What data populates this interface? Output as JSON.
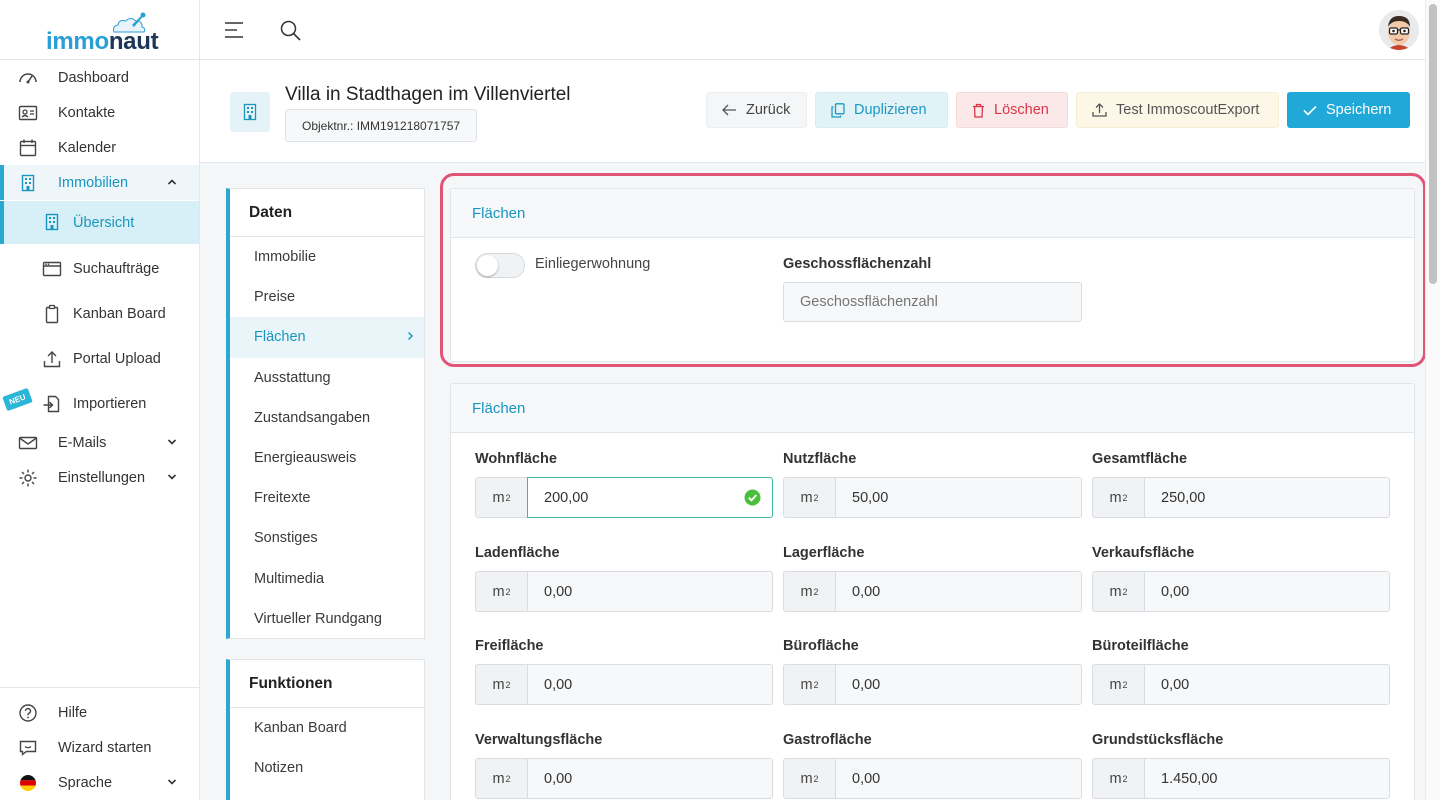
{
  "app": {
    "logo_part1": "immo",
    "logo_part2": "naut"
  },
  "sidebar": {
    "items": [
      {
        "label": "Dashboard",
        "icon": "dashboard-icon"
      },
      {
        "label": "Kontakte",
        "icon": "contacts-icon"
      },
      {
        "label": "Kalender",
        "icon": "calendar-icon"
      },
      {
        "label": "Immobilien",
        "icon": "building-icon"
      },
      {
        "label": "Übersicht",
        "icon": "building-icon"
      },
      {
        "label": "Suchaufträge",
        "icon": "browser-icon"
      },
      {
        "label": "Kanban Board",
        "icon": "clipboard-icon"
      },
      {
        "label": "Portal Upload",
        "icon": "upload-icon"
      },
      {
        "label": "Importieren",
        "icon": "import-icon"
      },
      {
        "label": "E-Mails",
        "icon": "mail-icon"
      },
      {
        "label": "Einstellungen",
        "icon": "gear-icon"
      }
    ],
    "neu_badge": "NEU",
    "bottom": [
      {
        "label": "Hilfe",
        "icon": "help-icon"
      },
      {
        "label": "Wizard starten",
        "icon": "chat-icon"
      },
      {
        "label": "Sprache",
        "icon": "german-flag-icon"
      }
    ]
  },
  "header": {
    "title": "Villa in Stadthagen im Villenviertel",
    "object_number": "Objektnr.: IMM191218071757",
    "buttons": {
      "back": "Zurück",
      "duplicate": "Duplizieren",
      "delete": "Löschen",
      "export": "Test ImmoscoutExport",
      "save": "Speichern"
    }
  },
  "menu": {
    "daten_title": "Daten",
    "daten_items": [
      "Immobilie",
      "Preise",
      "Flächen",
      "Ausstattung",
      "Zustandsangaben",
      "Energieausweis",
      "Freitexte",
      "Sonstiges",
      "Multimedia",
      "Virtueller Rundgang"
    ],
    "funktionen_title": "Funktionen",
    "funktionen_items": [
      "Kanban Board",
      "Notizen"
    ]
  },
  "card1": {
    "title": "Flächen",
    "toggle_label": "Einliegerwohnung",
    "gfz_label": "Geschossflächenzahl",
    "gfz_placeholder": "Geschossflächenzahl"
  },
  "card2": {
    "title": "Flächen",
    "unit": "m",
    "unit_exp": "2",
    "fields": [
      {
        "label": "Wohnfläche",
        "value": "200,00"
      },
      {
        "label": "Nutzfläche",
        "value": "50,00"
      },
      {
        "label": "Gesamtfläche",
        "value": "250,00"
      },
      {
        "label": "Ladenfläche",
        "value": "0,00"
      },
      {
        "label": "Lagerfläche",
        "value": "0,00"
      },
      {
        "label": "Verkaufsfläche",
        "value": "0,00"
      },
      {
        "label": "Freifläche",
        "value": "0,00"
      },
      {
        "label": "Bürofläche",
        "value": "0,00"
      },
      {
        "label": "Büroteilfläche",
        "value": "0,00"
      },
      {
        "label": "Verwaltungsfläche",
        "value": "0,00"
      },
      {
        "label": "Gastrofläche",
        "value": "0,00"
      },
      {
        "label": "Grundstücksfläche",
        "value": "1.450,00"
      }
    ]
  },
  "colors": {
    "accent": "#20a8d8",
    "highlight": "#e05576",
    "danger": "#dc3545"
  }
}
